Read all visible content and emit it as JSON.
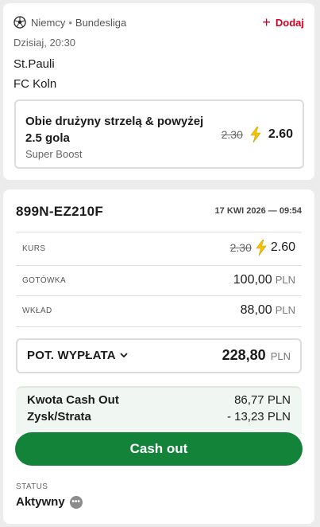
{
  "match": {
    "country": "Niemcy",
    "league": "Bundesliga",
    "add_label": "Dodaj",
    "date": "Dzisiaj, 20:30",
    "team_home": "St.Pauli",
    "team_away": "FC Koln",
    "bet": {
      "title": "Obie drużyny strzelą & powyżej 2.5 gola",
      "subtitle": "Super Boost",
      "old_odds": "2.30",
      "new_odds": "2.60"
    }
  },
  "ticket": {
    "id": "899N-EZ210F",
    "datetime": "17 KWI 2026 — 09:54",
    "kurs": {
      "label": "KURS",
      "old": "2.30",
      "new": "2.60"
    },
    "gotowka": {
      "label": "GOTÓWKA",
      "value": "100,00",
      "currency": "PLN"
    },
    "wklad": {
      "label": "WKŁAD",
      "value": "88,00",
      "currency": "PLN"
    },
    "payout": {
      "label": "POT. WYPŁATA",
      "value": "228,80",
      "currency": "PLN"
    },
    "cashout": {
      "amount_label": "Kwota Cash Out",
      "amount_value": "86,77",
      "amount_currency": "PLN",
      "pl_label": "Zysk/Strata",
      "pl_value": "- 13,23",
      "pl_currency": "PLN",
      "button_label": "Cash out"
    },
    "status": {
      "label": "STATUS",
      "value": "Aktywny"
    }
  },
  "colors": {
    "accent_red": "#d2001e",
    "cashout_green": "#13833a",
    "bolt_yellow": "#f5c400"
  },
  "icons": [
    "soccer-ball-icon",
    "plus-icon",
    "lightning-bolt-icon",
    "chevron-down-icon",
    "more-dots-icon"
  ]
}
